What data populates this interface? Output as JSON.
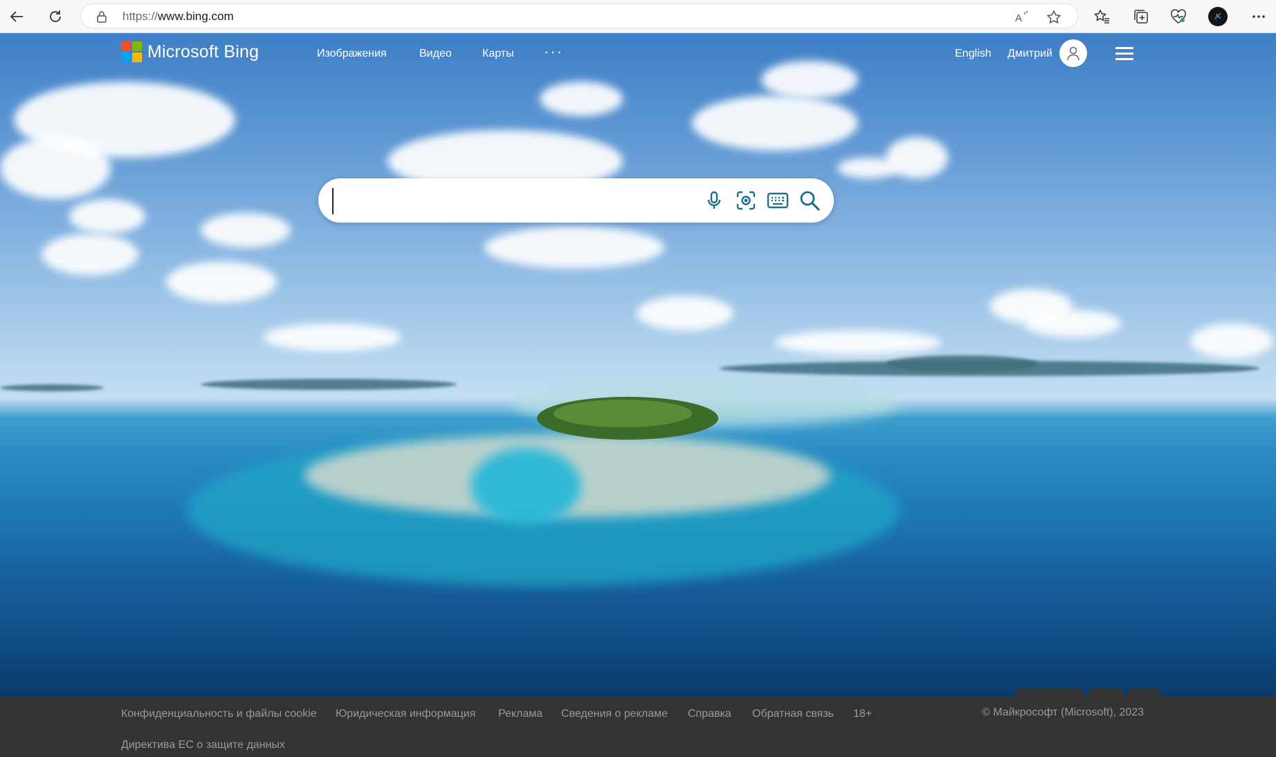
{
  "browser": {
    "url_scheme": "https://",
    "url_host": "www.bing.com"
  },
  "nav": {
    "brand": "Microsoft Bing",
    "links": [
      "Изображения",
      "Видео",
      "Карты"
    ],
    "more": "···",
    "language": "English",
    "user_name": "Дмитрий"
  },
  "search": {
    "value": "",
    "placeholder": ""
  },
  "footer": {
    "links": [
      "Конфиденциальность и файлы cookie",
      "Юридическая информация",
      "Реклама",
      "Сведения о рекламе",
      "Справка",
      "Обратная связь",
      "18+",
      "Директива ЕС о защите данных"
    ],
    "copyright": "© Майкрософт (Microsoft), 2023"
  },
  "colors": {
    "ms_red": "#f25022",
    "ms_green": "#7fba00",
    "ms_blue": "#00a4ef",
    "ms_yellow": "#ffb900",
    "search_icon_accent": "#1b6e8f",
    "footer_bg": "#333333"
  },
  "icons": [
    "back-icon",
    "refresh-icon",
    "lock-icon",
    "read-aloud-icon",
    "favorite-star-icon",
    "favorites-icon",
    "collections-icon",
    "health-icon",
    "profile-icon",
    "more-icon",
    "microphone-icon",
    "visual-search-icon",
    "keyboard-icon",
    "search-icon",
    "user-icon",
    "hamburger-icon"
  ]
}
